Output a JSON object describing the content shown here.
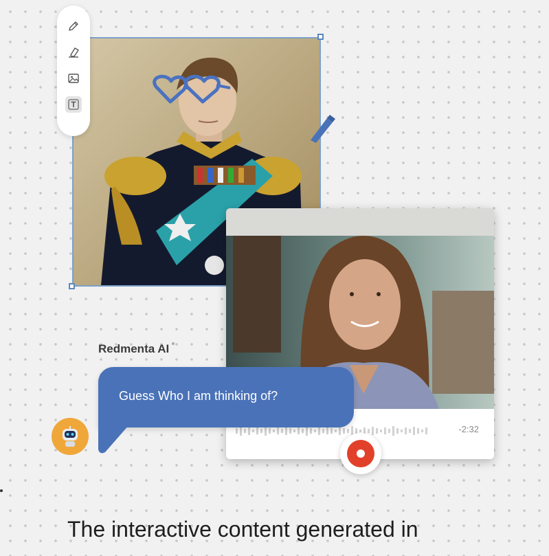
{
  "toolbar": {
    "tools": [
      {
        "icon": "pencil-icon"
      },
      {
        "icon": "eraser-icon"
      },
      {
        "icon": "image-icon"
      },
      {
        "icon": "text-icon",
        "active": true
      }
    ]
  },
  "assistant": {
    "name": "Redmenta AI",
    "message": "Guess Who I am thinking of?",
    "avatar_icon": "robot-avatar-icon"
  },
  "video": {
    "time": "-2:32"
  },
  "footer": {
    "line1": "The interactive content generated in"
  },
  "colors": {
    "accent": "#4a72b8",
    "record": "#e1412a",
    "avatar_bg": "#f0a73a",
    "selection": "#5b87c0"
  }
}
